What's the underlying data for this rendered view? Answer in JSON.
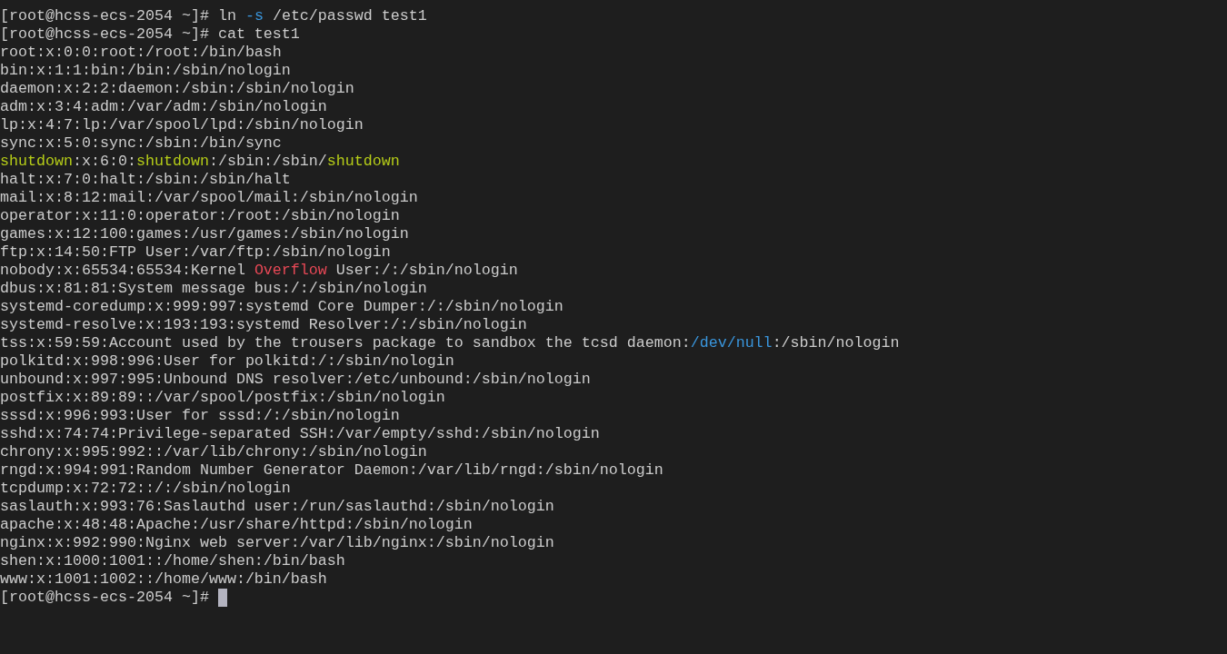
{
  "terminal": {
    "lines": [
      {
        "segments": [
          {
            "text": "[root@hcss-ecs-2054 ~]# ln "
          },
          {
            "text": "-s",
            "color": "#3a96dd"
          },
          {
            "text": " /etc/passwd test1"
          }
        ]
      },
      {
        "segments": [
          {
            "text": "[root@hcss-ecs-2054 ~]# cat test1"
          }
        ]
      },
      {
        "segments": [
          {
            "text": "root:x:0:0:root:/root:/bin/bash"
          }
        ]
      },
      {
        "segments": [
          {
            "text": "bin:x:1:1:bin:/bin:/sbin/nologin"
          }
        ]
      },
      {
        "segments": [
          {
            "text": "daemon:x:2:2:daemon:/sbin:/sbin/nologin"
          }
        ]
      },
      {
        "segments": [
          {
            "text": "adm:x:3:4:adm:/var/adm:/sbin/nologin"
          }
        ]
      },
      {
        "segments": [
          {
            "text": "lp:x:4:7:lp:/var/spool/lpd:/sbin/nologin"
          }
        ]
      },
      {
        "segments": [
          {
            "text": "sync:x:5:0:sync:/sbin:/bin/sync"
          }
        ]
      },
      {
        "segments": [
          {
            "text": "shutdown",
            "color": "#b5cc18"
          },
          {
            "text": ":x:6:0:"
          },
          {
            "text": "shutdown",
            "color": "#b5cc18"
          },
          {
            "text": ":/sbin:/sbin/"
          },
          {
            "text": "shutdown",
            "color": "#b5cc18"
          }
        ]
      },
      {
        "segments": [
          {
            "text": "halt:x:7:0:halt:/sbin:/sbin/halt"
          }
        ]
      },
      {
        "segments": [
          {
            "text": "mail:x:8:12:mail:/var/spool/mail:/sbin/nologin"
          }
        ]
      },
      {
        "segments": [
          {
            "text": "operator:x:11:0:operator:/root:/sbin/nologin"
          }
        ]
      },
      {
        "segments": [
          {
            "text": "games:x:12:100:games:/usr/games:/sbin/nologin"
          }
        ]
      },
      {
        "segments": [
          {
            "text": "ftp:x:14:50:FTP User:/var/ftp:/sbin/nologin"
          }
        ]
      },
      {
        "segments": [
          {
            "text": "nobody:x:65534:65534:Kernel "
          },
          {
            "text": "Overflow",
            "color": "#e74856"
          },
          {
            "text": " User:/:/sbin/nologin"
          }
        ]
      },
      {
        "segments": [
          {
            "text": "dbus:x:81:81:System message bus:/:/sbin/nologin"
          }
        ]
      },
      {
        "segments": [
          {
            "text": "systemd-coredump:x:999:997:systemd Core Dumper:/:/sbin/nologin"
          }
        ]
      },
      {
        "segments": [
          {
            "text": "systemd-resolve:x:193:193:systemd Resolver:/:/sbin/nologin"
          }
        ]
      },
      {
        "segments": [
          {
            "text": "tss:x:59:59:Account used by the trousers package to sandbox the tcsd daemon:"
          },
          {
            "text": "/dev/null",
            "color": "#3a96dd"
          },
          {
            "text": ":/sbin/nologin"
          }
        ]
      },
      {
        "segments": [
          {
            "text": "polkitd:x:998:996:User for polkitd:/:/sbin/nologin"
          }
        ]
      },
      {
        "segments": [
          {
            "text": "unbound:x:997:995:Unbound DNS resolver:/etc/unbound:/sbin/nologin"
          }
        ]
      },
      {
        "segments": [
          {
            "text": "postfix:x:89:89::/var/spool/postfix:/sbin/nologin"
          }
        ]
      },
      {
        "segments": [
          {
            "text": "sssd:x:996:993:User for sssd:/:/sbin/nologin"
          }
        ]
      },
      {
        "segments": [
          {
            "text": "sshd:x:74:74:Privilege-separated SSH:/var/empty/sshd:/sbin/nologin"
          }
        ]
      },
      {
        "segments": [
          {
            "text": "chrony:x:995:992::/var/lib/chrony:/sbin/nologin"
          }
        ]
      },
      {
        "segments": [
          {
            "text": "rngd:x:994:991:Random Number Generator Daemon:/var/lib/rngd:/sbin/nologin"
          }
        ]
      },
      {
        "segments": [
          {
            "text": "tcpdump:x:72:72::/:/sbin/nologin"
          }
        ]
      },
      {
        "segments": [
          {
            "text": "saslauth:x:993:76:Saslauthd user:/run/saslauthd:/sbin/nologin"
          }
        ]
      },
      {
        "segments": [
          {
            "text": "apache:x:48:48:Apache:/usr/share/httpd:/sbin/nologin"
          }
        ]
      },
      {
        "segments": [
          {
            "text": "nginx:x:992:990:Nginx web server:/var/lib/nginx:/sbin/nologin"
          }
        ]
      },
      {
        "segments": [
          {
            "text": "shen:x:1000:1001::/home/shen:/bin/bash"
          }
        ]
      },
      {
        "segments": [
          {
            "text": "www:x:1001:1002::/home/www:/bin/bash"
          }
        ]
      },
      {
        "segments": [
          {
            "text": "[root@hcss-ecs-2054 ~]# "
          }
        ],
        "cursor": true
      }
    ]
  }
}
